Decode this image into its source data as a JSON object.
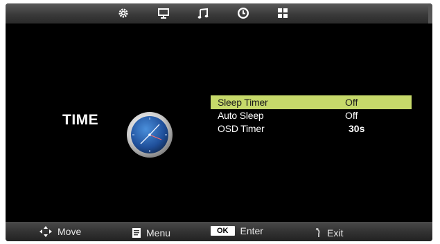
{
  "tabs": [
    {
      "icon": "picture-gear-icon",
      "active": false
    },
    {
      "icon": "monitor-icon",
      "active": false
    },
    {
      "icon": "music-note-icon",
      "active": false
    },
    {
      "icon": "clock-icon",
      "active": true
    },
    {
      "icon": "grid-icon",
      "active": false
    }
  ],
  "section": {
    "title": "TIME",
    "icon": "clock-icon"
  },
  "menu": {
    "items": [
      {
        "label": "Sleep Timer",
        "value": "Off",
        "selected": true
      },
      {
        "label": "Auto Sleep",
        "value": "Off",
        "selected": false
      },
      {
        "label": "OSD Timer",
        "value": "30s",
        "selected": false
      }
    ]
  },
  "footer": {
    "move": {
      "label": "Move",
      "icon": "dpad-arrows-icon"
    },
    "menu": {
      "label": "Menu",
      "icon": "menu-doc-icon"
    },
    "enter": {
      "label": "Enter",
      "key": "OK"
    },
    "exit": {
      "label": "Exit",
      "icon": "exit-return-icon"
    }
  },
  "colors": {
    "highlight": "#c6d96a",
    "background": "#000000",
    "bar": "#3a3a3a"
  }
}
